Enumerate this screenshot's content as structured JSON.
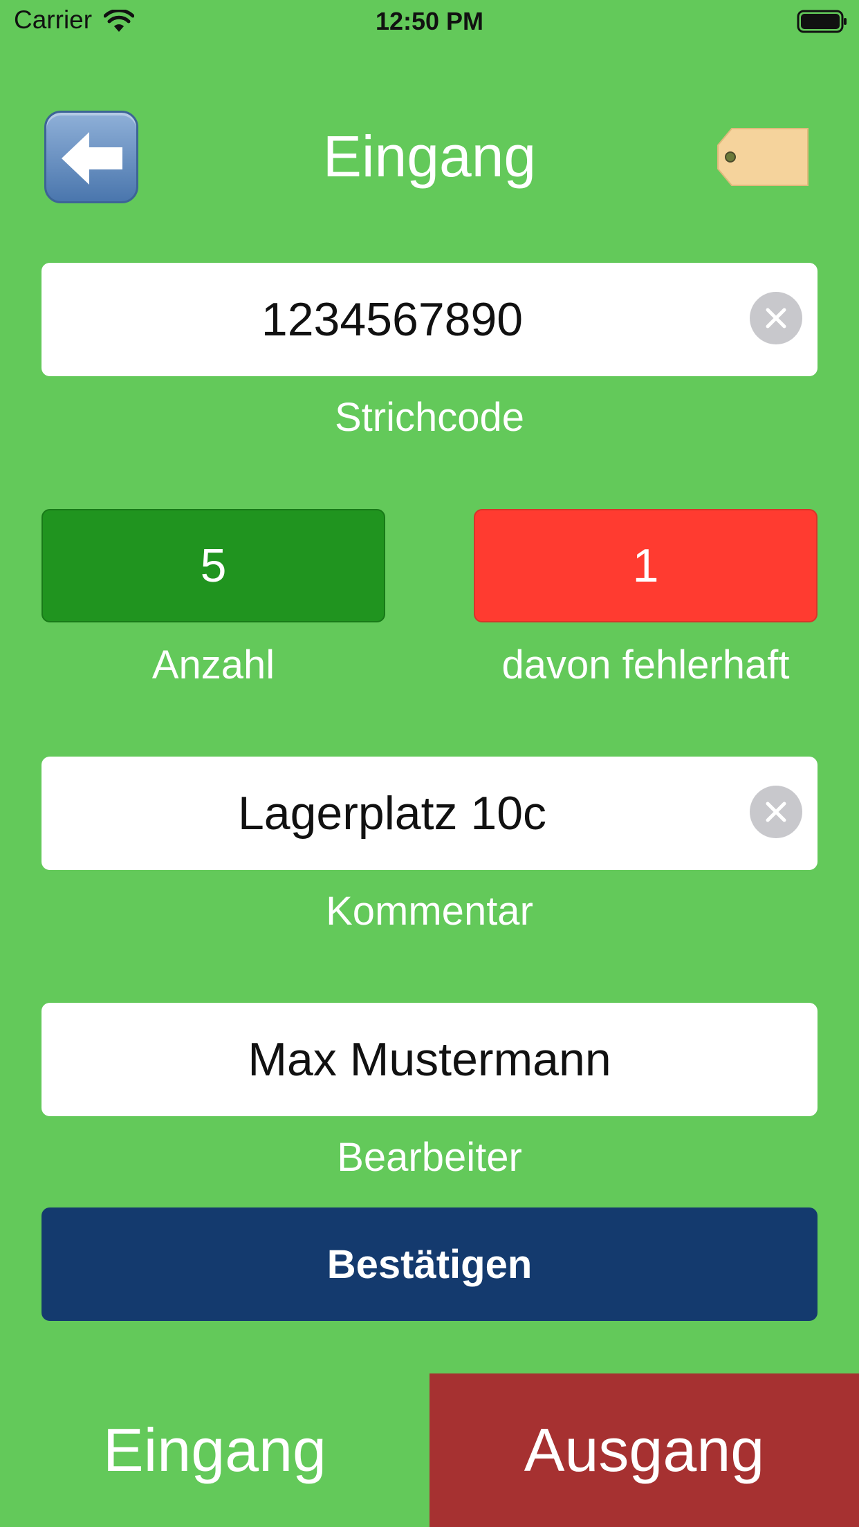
{
  "status_bar": {
    "carrier": "Carrier",
    "time": "12:50 PM"
  },
  "header": {
    "title": "Eingang",
    "back_icon": "left-arrow-icon",
    "tag_icon": "tag-icon"
  },
  "barcode": {
    "value": "1234567890",
    "label": "Strichcode"
  },
  "quantity": {
    "value": "5",
    "label": "Anzahl"
  },
  "defective": {
    "value": "1",
    "label": "davon fehlerhaft"
  },
  "comment": {
    "value": "Lagerplatz 10c",
    "label": "Kommentar"
  },
  "editor": {
    "value": "Max Mustermann",
    "label": "Bearbeiter"
  },
  "confirm_label": "Bestätigen",
  "tabs": [
    {
      "label": "Eingang",
      "selected": true
    },
    {
      "label": "Ausgang",
      "selected": false
    }
  ],
  "colors": {
    "background": "#63c95a",
    "quantity": "#20941f",
    "defective": "#ff3b30",
    "confirm": "#143a6e",
    "tab_ausgang": "#a63131"
  }
}
